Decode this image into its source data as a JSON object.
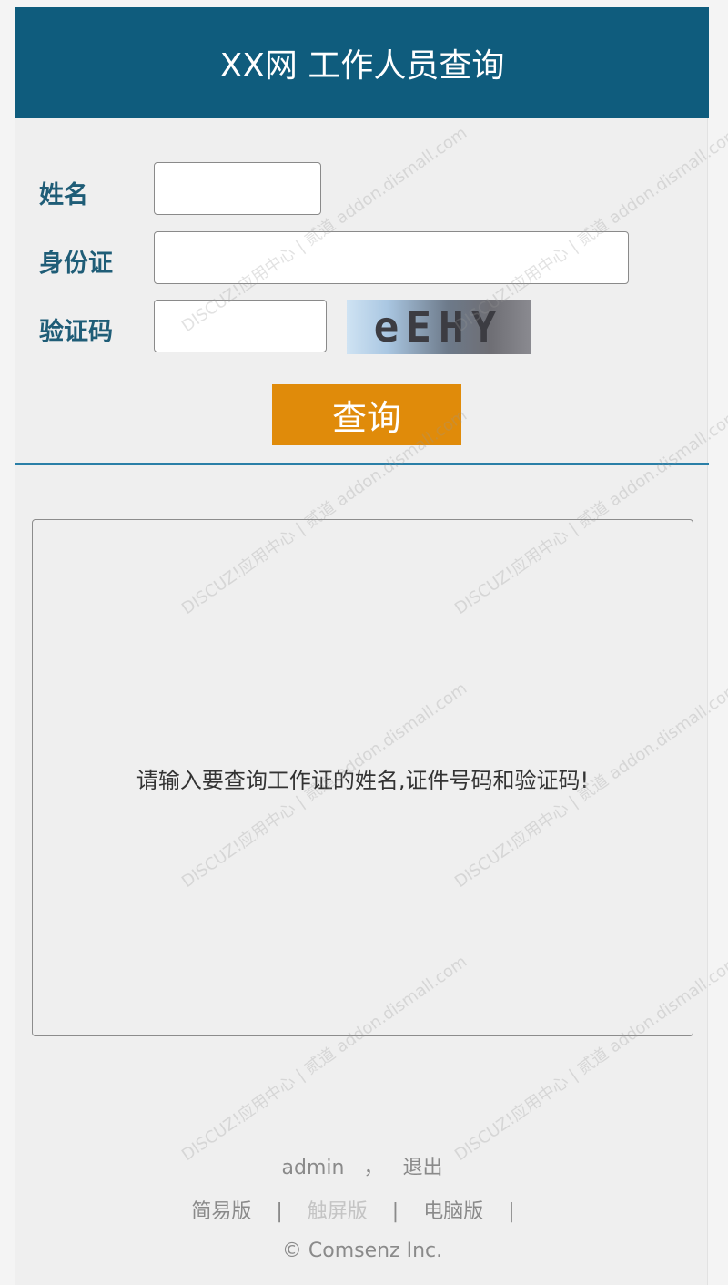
{
  "header": {
    "title": "XX网 工作人员查询"
  },
  "form": {
    "name_label": "姓名",
    "id_label": "身份证",
    "captcha_label": "验证码",
    "name_value": "",
    "id_value": "",
    "captcha_value": "",
    "captcha_image_text": "eEHY",
    "submit_label": "查询"
  },
  "result": {
    "message": "请输入要查询工作证的姓名,证件号码和验证码!"
  },
  "footer": {
    "user": "admin",
    "user_sep": "，",
    "logout": "退出",
    "links": [
      "简易版",
      "触屏版",
      "电脑版"
    ],
    "link_sep": "|",
    "copyright": "© Comsenz Inc."
  },
  "watermark": {
    "text": "DISCUZ!应用中心 | 贰道 addon.dismall.com"
  }
}
